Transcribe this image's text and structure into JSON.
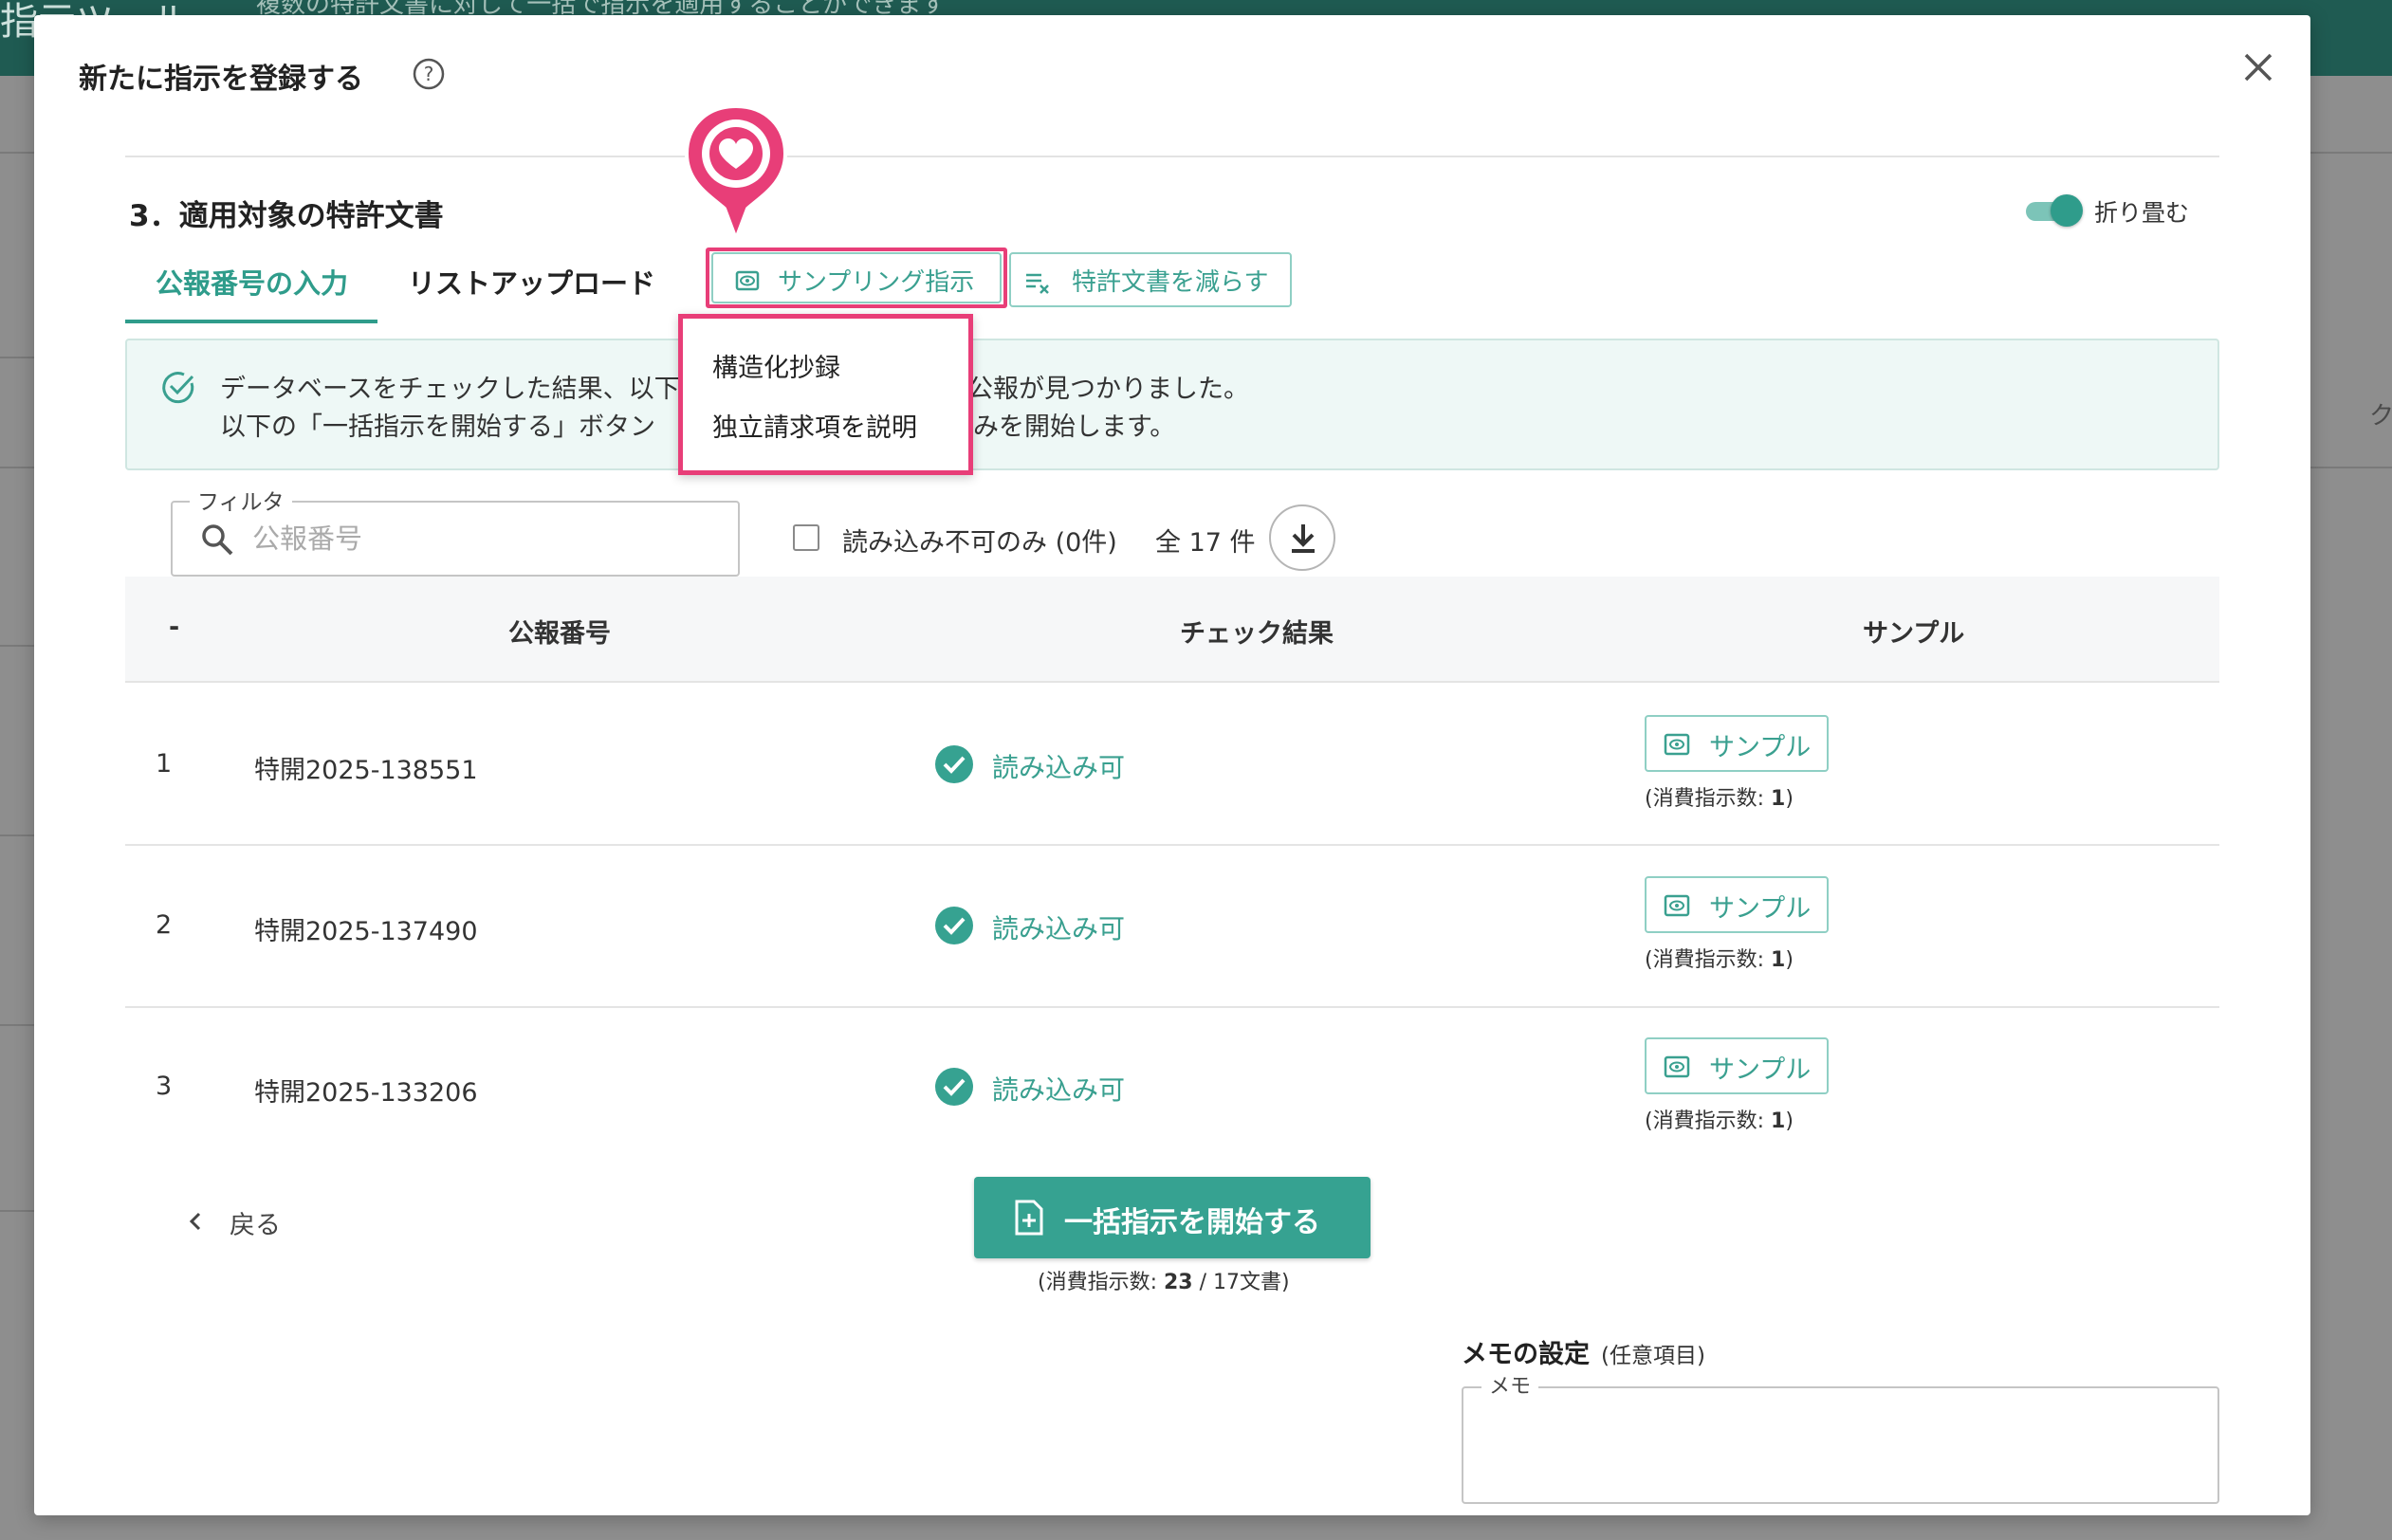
{
  "background": {
    "header_title": "指示ツール",
    "header_subtitle": "複数の特許文書に対して一括で指示を適用することができます",
    "right_text": "ク"
  },
  "modal": {
    "title": "新たに指示を登録する",
    "section_title": "3．適用対象の特許文書",
    "toggle": {
      "label": "折り畳む",
      "on": true
    },
    "tabs": [
      {
        "label": "公報番号の入力",
        "active": true
      },
      {
        "label": "リストアップロード",
        "active": false
      }
    ],
    "actions": {
      "sampling": {
        "label": "サンプリング指示",
        "icon": "eye-doc-icon"
      },
      "reduce": {
        "label": "特許文書を減らす",
        "icon": "list-remove-icon"
      }
    },
    "dropdown": {
      "items": [
        "構造化抄録",
        "独立請求項を説明"
      ]
    },
    "alert": {
      "line1_a": "データベースをチェックした結果、以下",
      "line1_b": "公報が見つかりました。",
      "line2_a": "以下の「一括指示を開始する」ボタン",
      "line2_b": "みを開始します。"
    },
    "filter": {
      "legend": "フィルタ",
      "placeholder": "公報番号",
      "value": ""
    },
    "unreadable_only": {
      "label": "読み込み不可のみ (0件)",
      "checked": false
    },
    "total": "全 17 件",
    "table": {
      "headers": [
        "-",
        "公報番号",
        "チェック結果",
        "サンプル"
      ],
      "rows": [
        {
          "index": "1",
          "number": "特開2025-138551",
          "status": "読み込み可",
          "sample_label": "サンプル",
          "note_prefix": "(消費指示数: ",
          "note_value": "1",
          "note_suffix": ")"
        },
        {
          "index": "2",
          "number": "特開2025-137490",
          "status": "読み込み可",
          "sample_label": "サンプル",
          "note_prefix": "(消費指示数: ",
          "note_value": "1",
          "note_suffix": ")"
        },
        {
          "index": "3",
          "number": "特開2025-133206",
          "status": "読み込み可",
          "sample_label": "サンプル",
          "note_prefix": "(消費指示数: ",
          "note_value": "1",
          "note_suffix": ")"
        }
      ]
    },
    "back_label": "戻る",
    "start_button": {
      "label": "一括指示を開始する",
      "note_prefix": "(消費指示数: ",
      "note_value": "23",
      "note_suffix": " / 17文書)"
    },
    "memo": {
      "title": "メモの設定",
      "optional": "(任意項目)",
      "legend": "メモ",
      "value": ""
    }
  },
  "colors": {
    "accent": "#2f9c8b",
    "highlight": "#e83e78",
    "alert_bg": "#eef8f6"
  }
}
